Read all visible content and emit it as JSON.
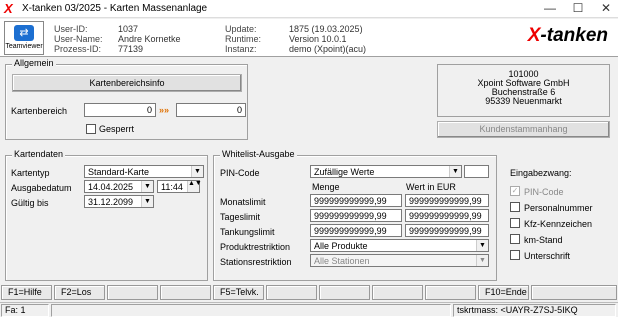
{
  "window": {
    "title": "X-tanken 03/2025 - Karten Massenanlage",
    "logo": "X",
    "minimize": "—",
    "maximize": "☐",
    "close": "✕"
  },
  "header": {
    "teamviewer_label": "Teamviewer",
    "user_id_label": "User-ID:",
    "user_id": "1037",
    "user_name_label": "User-Name:",
    "user_name": "Andre Kornetke",
    "prozess_id_label": "Prozess-ID:",
    "prozess_id": "77139",
    "update_label": "Update:",
    "update": "1875 (19.03.2025)",
    "runtime_label": "Runtime:",
    "runtime": "Version 10.0.1",
    "instanz_label": "Instanz:",
    "instanz": "demo (Xpoint)(acu)",
    "brand_x": "X",
    "brand_rest": "-tanken"
  },
  "allgemein": {
    "legend": "Allgemein",
    "kartenbereichsinfo_button": "Kartenbereichsinfo",
    "kartenbereich_label": "Kartenbereich",
    "kartenbereich_from": "0",
    "kartenbereich_to": "0",
    "arrow": "»»",
    "gesperrt_label": "Gesperrt"
  },
  "customer": {
    "number": "101000",
    "name": "Xpoint Software GmbH",
    "street": "Buchenstraße 6",
    "city": "95339 Neuenmarkt",
    "kundenstammanhang_button": "Kundenstammanhang"
  },
  "kartendaten": {
    "legend": "Kartendaten",
    "kartentyp_label": "Kartentyp",
    "kartentyp": "Standard-Karte",
    "ausgabedatum_label": "Ausgabedatum",
    "ausgabedatum": "14.04.2025",
    "ausgabezeit": "11:44",
    "gueltig_label": "Gültig bis",
    "gueltig": "31.12.2099"
  },
  "whitelist": {
    "legend": "Whitelist-Ausgabe",
    "pin_label": "PIN-Code",
    "pin_value": "Zufällige Werte",
    "menge_header": "Menge",
    "wert_header": "Wert in EUR",
    "rows": [
      {
        "label": "Monatslimit",
        "menge": "999999999999,99",
        "wert": "999999999999,99"
      },
      {
        "label": "Tageslimit",
        "menge": "999999999999,99",
        "wert": "999999999999,99"
      },
      {
        "label": "Tankungslimit",
        "menge": "999999999999,99",
        "wert": "999999999999,99"
      }
    ],
    "produkt_label": "Produktrestriktion",
    "produkt_value": "Alle Produkte",
    "station_label": "Stationsrestriktion",
    "station_value": "Alle Stationen"
  },
  "eingabezwang": {
    "title": "Eingabezwang:",
    "items": [
      {
        "label": "PIN-Code",
        "checked": "✓"
      },
      {
        "label": "Personalnummer",
        "checked": ""
      },
      {
        "label": "Kfz-Kennzeichen",
        "checked": ""
      },
      {
        "label": "km-Stand",
        "checked": ""
      },
      {
        "label": "Unterschrift",
        "checked": ""
      }
    ]
  },
  "fkeys": [
    "F1=Hilfe",
    "F2=Los",
    "",
    "",
    "F5=Telvk.",
    "",
    "",
    "",
    "F10=Ende",
    ""
  ],
  "status": {
    "left": "Fa: 1",
    "right": "tskrtmass: <UAYR-Z7SJ-5IKQ"
  }
}
